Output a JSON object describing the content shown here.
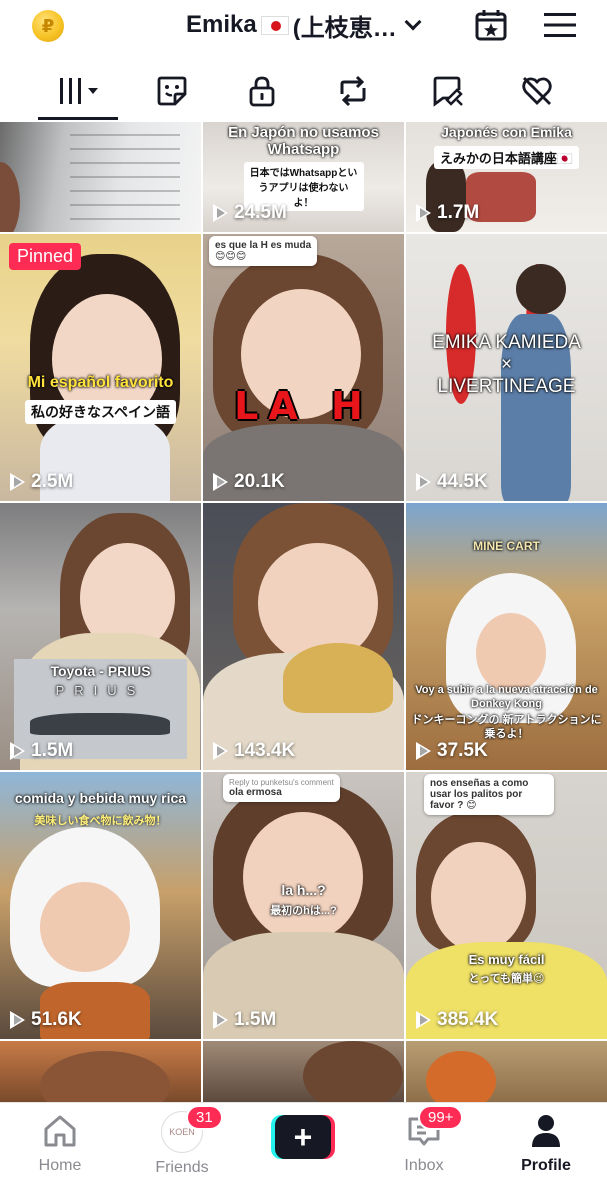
{
  "header": {
    "coin_icon": "coin-icon",
    "profile_name": "Emika",
    "profile_name_suffix": "(上枝恵…",
    "flag_icon": "japan-flag-icon",
    "calendar_icon": "calendar-star-icon",
    "menu_icon": "hamburger-menu-icon"
  },
  "tabs": [
    {
      "name": "videos",
      "icon": "grid-icon",
      "active": true
    },
    {
      "name": "favorites",
      "icon": "sticker-icon"
    },
    {
      "name": "private",
      "icon": "lock-icon"
    },
    {
      "name": "reposts",
      "icon": "repost-icon"
    },
    {
      "name": "tagged",
      "icon": "tag-icon"
    },
    {
      "name": "liked",
      "icon": "heart-icon"
    }
  ],
  "videos": [
    {
      "views": "",
      "caption": ""
    },
    {
      "views": "24.5M",
      "caption": "En Japón no usamos Whatsapp",
      "sub": "日本ではWhatsappとい うアプリは使わないよ！"
    },
    {
      "views": "1.7M",
      "caption": "Japonés con Emika",
      "sub": "えみかの日本語講座🇯🇵"
    },
    {
      "views": "2.5M",
      "pinned": "Pinned",
      "caption": "Mi español favorito",
      "sub": "私の好きなスペイン語"
    },
    {
      "views": "20.1K",
      "caption": "LA H",
      "comment": "es que la H es muda",
      "comment_emoji": "😊😊😊"
    },
    {
      "views": "44.5K",
      "caption": "EMIKA KAMIEDA",
      "caption_x": "×",
      "caption2": "LIVERTINEAGE"
    },
    {
      "views": "1.5M",
      "caption": "Toyota - PRIUS",
      "sub": "PRIUS"
    },
    {
      "views": "143.4K",
      "caption": ""
    },
    {
      "views": "37.5K",
      "caption": "Voy a subir a la nueva atracción de Donkey Kong",
      "sub": "ドンキーコングの 新アトラクションに乗るよ！",
      "sign": "MINE CART"
    },
    {
      "views": "51.6K",
      "caption": "comida y bebida muy rica",
      "sub": "美味しい食べ物に飲み物！"
    },
    {
      "views": "1.5M",
      "caption": "la h...?",
      "sub": "最初のhは...?",
      "comment_header": "Reply to punketsu's comment",
      "comment": "ola ermosa"
    },
    {
      "views": "385.4K",
      "caption": "Es muy fácil",
      "sub": "とっても簡単😉",
      "comment": "nos enseñas a como usar los palitos por favor ? 😊"
    }
  ],
  "bottom_nav": {
    "home": "Home",
    "friends": "Friends",
    "friends_badge": "31",
    "friends_avatar_text": "KOEN",
    "inbox": "Inbox",
    "inbox_badge": "99+",
    "profile": "Profile",
    "create_icon": "plus-icon"
  }
}
